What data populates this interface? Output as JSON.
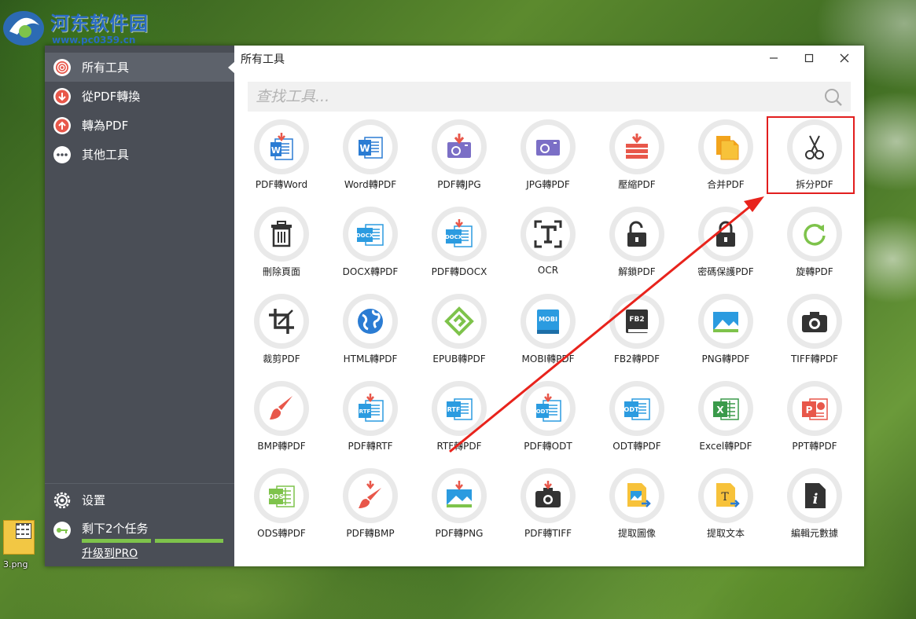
{
  "watermark": {
    "title": "河东软件园",
    "url": "www.pc0359.cn"
  },
  "desktop_icon": {
    "label": "3.png"
  },
  "window": {
    "title": "所有工具"
  },
  "sidebar": {
    "items": [
      {
        "label": "所有工具",
        "icon": "target-icon",
        "active": true
      },
      {
        "label": "從PDF轉換",
        "icon": "arrow-down-icon"
      },
      {
        "label": "轉為PDF",
        "icon": "arrow-up-icon"
      },
      {
        "label": "其他工具",
        "icon": "more-icon"
      }
    ],
    "settings": "设置",
    "tasks": {
      "text": "剩下2个任务",
      "remaining_fraction": 1.0
    },
    "upgrade": "升级到PRO"
  },
  "search": {
    "placeholder": "查找工具..."
  },
  "tools": [
    {
      "label": "PDF轉Word",
      "icon": "pdf-to-word-icon"
    },
    {
      "label": "Word轉PDF",
      "icon": "word-icon"
    },
    {
      "label": "PDF轉JPG",
      "icon": "pdf-to-jpg-icon"
    },
    {
      "label": "JPG轉PDF",
      "icon": "jpg-icon"
    },
    {
      "label": "壓縮PDF",
      "icon": "compress-icon"
    },
    {
      "label": "合并PDF",
      "icon": "merge-icon"
    },
    {
      "label": "拆分PDF",
      "icon": "scissors-icon",
      "highlighted": true
    },
    {
      "label": "刪除頁面",
      "icon": "trash-icon"
    },
    {
      "label": "DOCX轉PDF",
      "icon": "docx-icon"
    },
    {
      "label": "PDF轉DOCX",
      "icon": "pdf-to-docx-icon"
    },
    {
      "label": "OCR",
      "icon": "ocr-icon"
    },
    {
      "label": "解鎖PDF",
      "icon": "unlock-icon"
    },
    {
      "label": "密碼保護PDF",
      "icon": "lock-icon"
    },
    {
      "label": "旋轉PDF",
      "icon": "rotate-icon"
    },
    {
      "label": "裁剪PDF",
      "icon": "crop-icon"
    },
    {
      "label": "HTML轉PDF",
      "icon": "globe-icon"
    },
    {
      "label": "EPUB轉PDF",
      "icon": "epub-icon"
    },
    {
      "label": "MOBI轉PDF",
      "icon": "mobi-icon"
    },
    {
      "label": "FB2轉PDF",
      "icon": "fb2-icon"
    },
    {
      "label": "PNG轉PDF",
      "icon": "png-image-icon"
    },
    {
      "label": "TIFF轉PDF",
      "icon": "camera-icon"
    },
    {
      "label": "BMP轉PDF",
      "icon": "paint-brush-icon"
    },
    {
      "label": "PDF轉RTF",
      "icon": "pdf-to-rtf-icon"
    },
    {
      "label": "RTF轉PDF",
      "icon": "rtf-icon"
    },
    {
      "label": "PDF轉ODT",
      "icon": "pdf-to-odt-icon"
    },
    {
      "label": "ODT轉PDF",
      "icon": "odt-icon"
    },
    {
      "label": "Excel轉PDF",
      "icon": "excel-icon"
    },
    {
      "label": "PPT轉PDF",
      "icon": "ppt-icon"
    },
    {
      "label": "ODS轉PDF",
      "icon": "ods-icon"
    },
    {
      "label": "PDF轉BMP",
      "icon": "pdf-to-bmp-icon"
    },
    {
      "label": "PDF轉PNG",
      "icon": "pdf-to-png-icon"
    },
    {
      "label": "PDF轉TIFF",
      "icon": "pdf-to-tiff-icon"
    },
    {
      "label": "提取圖像",
      "icon": "extract-image-icon"
    },
    {
      "label": "提取文本",
      "icon": "extract-text-icon"
    },
    {
      "label": "編輯元數據",
      "icon": "info-doc-icon"
    }
  ],
  "colors": {
    "sidebar": "#4a4e56",
    "accent_green": "#7ec34b",
    "highlight_red": "#e21e1e",
    "word_blue": "#2b7cd3",
    "pdf_red": "#e8574a"
  }
}
